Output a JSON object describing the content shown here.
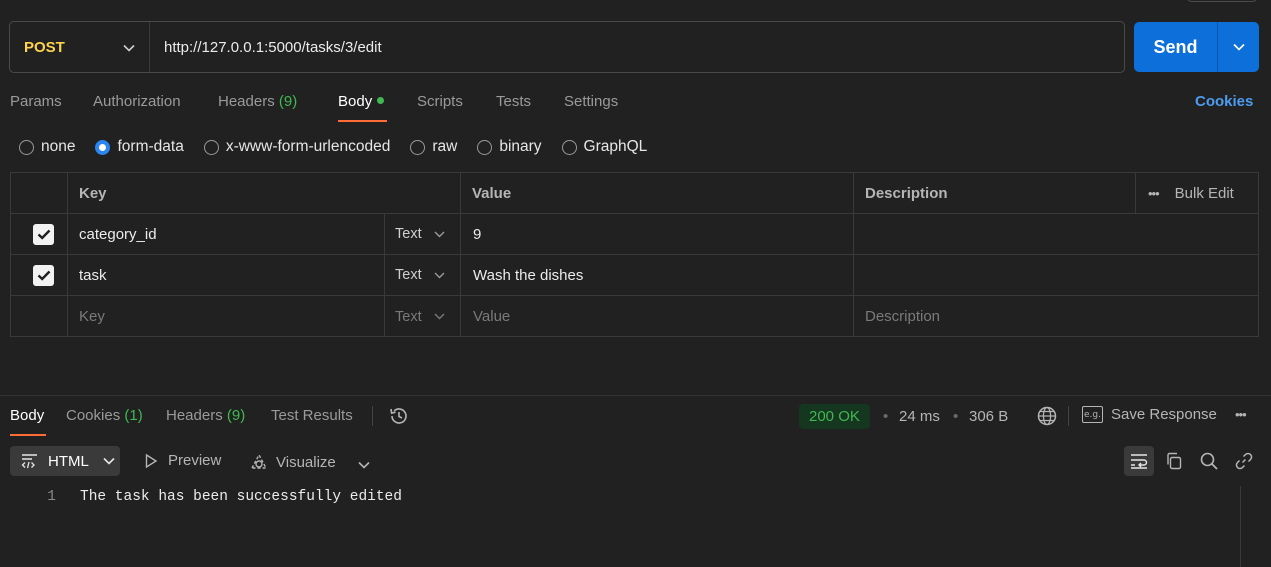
{
  "request": {
    "method": "POST",
    "url": "http://127.0.0.1:5000/tasks/3/edit",
    "send_label": "Send"
  },
  "tabs": {
    "params": "Params",
    "authorization": "Authorization",
    "headers": "Headers",
    "headers_count": "(9)",
    "body": "Body",
    "scripts": "Scripts",
    "tests": "Tests",
    "settings": "Settings",
    "cookies": "Cookies"
  },
  "body_modes": {
    "none": "none",
    "form_data": "form-data",
    "urlencoded": "x-www-form-urlencoded",
    "raw": "raw",
    "binary": "binary",
    "graphql": "GraphQL",
    "selected": "form-data"
  },
  "form_table": {
    "headers": {
      "key": "Key",
      "value": "Value",
      "description": "Description",
      "bulk_edit": "Bulk Edit"
    },
    "rows": [
      {
        "checked": true,
        "key": "category_id",
        "type": "Text",
        "value": "9",
        "description": ""
      },
      {
        "checked": true,
        "key": "task",
        "type": "Text",
        "value": "Wash the dishes",
        "description": ""
      }
    ],
    "placeholder": {
      "key": "Key",
      "type": "Text",
      "value": "Value",
      "description": "Description"
    }
  },
  "response": {
    "tabs": {
      "body": "Body",
      "cookies": "Cookies",
      "cookies_count": "(1)",
      "headers": "Headers",
      "headers_count": "(9)",
      "test_results": "Test Results"
    },
    "status": "200 OK",
    "time": "24 ms",
    "size": "306 B",
    "save_response": "Save Response",
    "format": "HTML",
    "preview": "Preview",
    "visualize": "Visualize",
    "lines": [
      {
        "number": "1",
        "text": "The task has been successfully edited"
      }
    ]
  },
  "colors": {
    "accent_orange": "#ff6c37",
    "send_blue": "#0d6fd9",
    "method_yellow": "#ffd34e",
    "status_green": "#3fb950",
    "link_blue": "#4c9cf0"
  }
}
